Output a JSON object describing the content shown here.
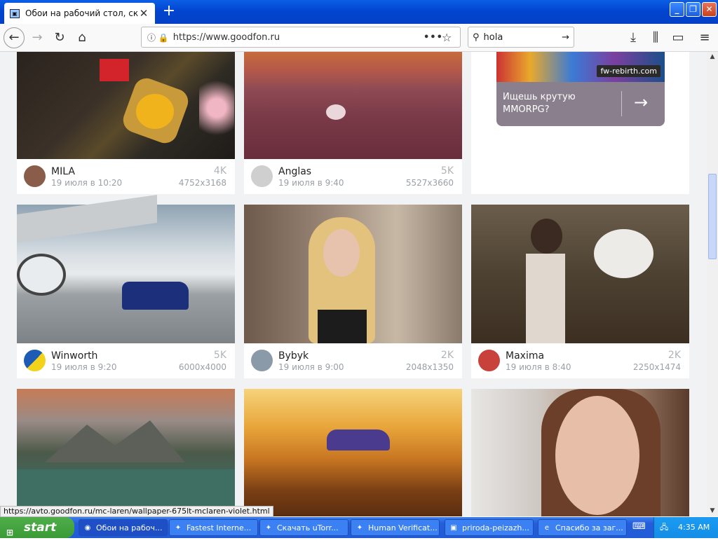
{
  "window": {
    "tab_title": "Обои на рабочий стол, скачать"
  },
  "nav": {
    "url": "https://www.goodfon.ru",
    "search_value": "hola"
  },
  "ad": {
    "brand": "fw-rebirth.com",
    "text": "Ищешь крутую MMORPG?"
  },
  "cards": [
    {
      "name": "MILA",
      "date": "19 июля в 10:20",
      "views": "4K",
      "res": "4752x3168"
    },
    {
      "name": "Anglas",
      "date": "19 июля в 9:40",
      "views": "5K",
      "res": "5527x3660"
    },
    {
      "name": "Winworth",
      "date": "19 июля в 9:20",
      "views": "5K",
      "res": "6000x4000"
    },
    {
      "name": "Bybyk",
      "date": "19 июля в 9:00",
      "views": "2K",
      "res": "2048x1350"
    },
    {
      "name": "Maxima",
      "date": "19 июля в 8:40",
      "views": "2K",
      "res": "2250x1474"
    }
  ],
  "status_url": "https://avto.goodfon.ru/mc-laren/wallpaper-675lt-mclaren-violet.html",
  "taskbar": {
    "start": "start",
    "items": [
      "Обои на рабоч...",
      "Fastest Interne...",
      "Скачать uTorr...",
      "Human Verificat...",
      "priroda-peizazh...",
      "Спасибо за заг..."
    ],
    "clock": "4:35 AM"
  },
  "colors": {
    "accent": "#0a5fe5",
    "taskbar": "#245ddb",
    "start": "#3a9a36"
  }
}
